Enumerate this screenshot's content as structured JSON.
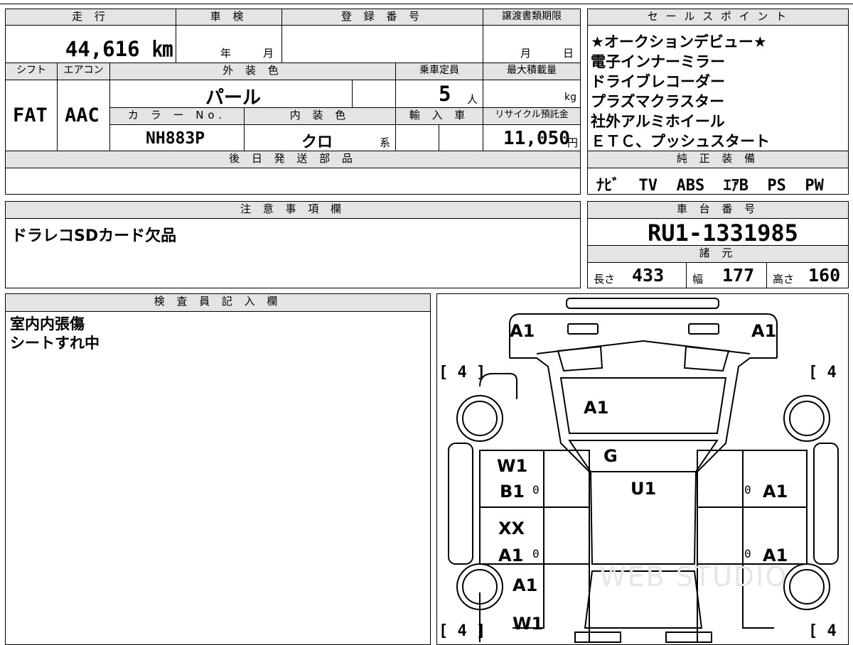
{
  "vehicle": {
    "mileage_label": "走 行",
    "mileage_value": "44,616 ㎞",
    "shaken_label": "車 検",
    "shaken_year": "年",
    "shaken_month": "月",
    "reg_number_label": "登 録 番 号",
    "transfer_deadline_label": "譲渡書類期限",
    "transfer_month": "月",
    "transfer_day": "日",
    "shift_label": "シフト",
    "shift_value": "FAT",
    "aircon_label": "エアコン",
    "aircon_value": "AAC",
    "ext_color_label": "外 装 色",
    "ext_color_value": "パール",
    "capacity_label": "乗車定員",
    "capacity_value": "5",
    "capacity_unit": "人",
    "max_load_label": "最大積載量",
    "max_load_unit": "kg",
    "color_no_label": "カ ラ ー No.",
    "color_no_value": "NH883P",
    "int_color_label": "内 装 色",
    "int_color_value": "クロ",
    "int_color_suffix": "系",
    "import_label": "輸 入 車",
    "recycle_label": "リサイクル預託金",
    "recycle_value": "11,050",
    "recycle_unit": "円",
    "later_parts_label": "後 日 発 送 部 品"
  },
  "sales_points": {
    "label": "セ ー ル ス ポ イ ン ト",
    "lines": [
      "★オークションデビュー★",
      "電子インナーミラー",
      "ドライブレコーダー",
      "プラズマクラスター",
      "社外アルミホイール",
      "ＥＴＣ、プッシュスタート"
    ]
  },
  "genuine_equipment": {
    "label": "純 正 装 備",
    "value": "ﾅﾋﾞ  TV  ABS  ｴｱB  PS  PW"
  },
  "notes": {
    "label": "注 意 事 項 欄",
    "text": "ドラレコSDカード欠品"
  },
  "chassis": {
    "label": "車 台 番 号",
    "value": "RU1-1331985",
    "specs_label": "諸 元",
    "length_label": "長さ",
    "length_value": "433",
    "width_label": "幅",
    "width_value": "177",
    "height_label": "高さ",
    "height_value": "160"
  },
  "inspector": {
    "label": "検 査 員 記 入 欄",
    "lines": [
      "室内内張傷",
      "シートすれ中"
    ]
  },
  "diagram": {
    "marks": {
      "front_left": "A1",
      "front_right": "A1",
      "hood": "A1",
      "windshield": "G",
      "roof": "U1",
      "front_door_left_1": "W1",
      "front_door_left_2": "B1",
      "rear_door_left_1": "XX",
      "rear_door_left_2": "A1",
      "rear_left_fender": "A1",
      "rear_left_quarter": "W1",
      "front_door_right": "A1",
      "rear_door_right": "A1",
      "zero": "0"
    },
    "tire_tl": "4",
    "tire_tr": "4",
    "tire_bl": "4",
    "tire_br": "4",
    "watermark": "WEB STUDIO"
  }
}
